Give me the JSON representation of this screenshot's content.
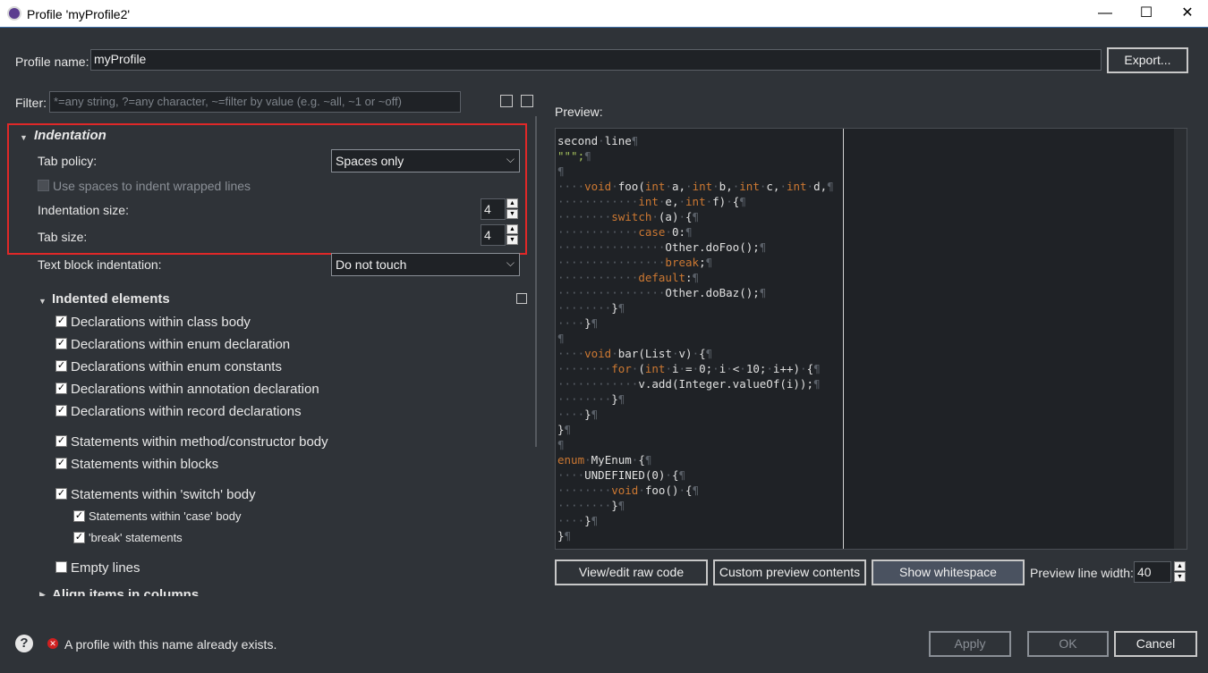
{
  "window": {
    "title": "Profile 'myProfile2'",
    "minimize": "—",
    "maximize": "☐",
    "close": "✕"
  },
  "profile": {
    "label": "Profile name:",
    "value": "myProfile",
    "export": "Export..."
  },
  "filter": {
    "label": "Filter:",
    "placeholder": "*=any string, ?=any character, ~=filter by value (e.g. ~all, ~1 or ~off)"
  },
  "indentation": {
    "heading": "Indentation",
    "tab_policy_label": "Tab policy:",
    "tab_policy_value": "Spaces only",
    "wrapped_label": "Use spaces to indent wrapped lines",
    "indent_size_label": "Indentation size:",
    "indent_size": "4",
    "tab_size_label": "Tab size:",
    "tab_size": "4",
    "text_block_label": "Text block indentation:",
    "text_block_value": "Do not touch"
  },
  "indented": {
    "heading": "Indented elements",
    "items": [
      "Declarations within class body",
      "Declarations within enum declaration",
      "Declarations within enum constants",
      "Declarations within annotation declaration",
      "Declarations within record declarations",
      "Statements within method/constructor body",
      "Statements within blocks",
      "Statements within 'switch' body",
      "Statements within 'case' body",
      "'break' statements",
      "Empty lines"
    ],
    "next_heading": "Align items in columns"
  },
  "preview": {
    "label": "Preview:",
    "view_raw": "View/edit raw code",
    "custom": "Custom preview contents",
    "show_ws": "Show whitespace",
    "line_width_label": "Preview line width:",
    "line_width": "40"
  },
  "footer": {
    "error": "A profile with this name already exists.",
    "apply": "Apply",
    "ok": "OK",
    "cancel": "Cancel"
  },
  "icons": [
    "app-icon",
    "expand-all-icon",
    "collapse-all-icon",
    "configure-icon",
    "help-icon",
    "error-icon"
  ]
}
